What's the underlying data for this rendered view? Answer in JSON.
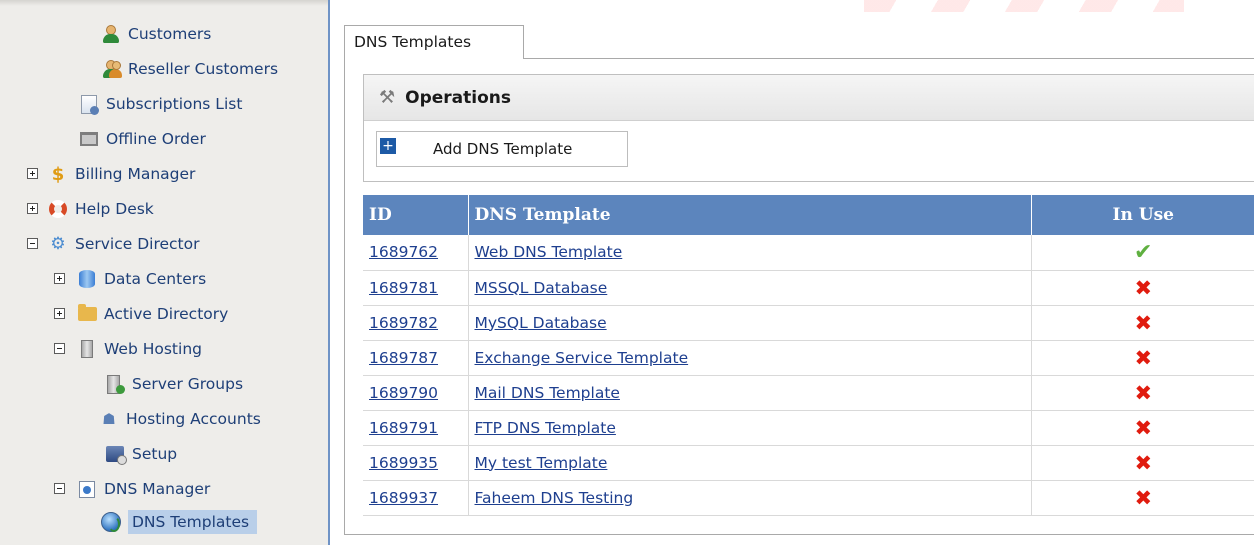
{
  "sidebar": {
    "items": [
      {
        "label": "Customers",
        "icon": "customers-icon"
      },
      {
        "label": "Reseller Customers",
        "icon": "reseller-customers-icon"
      },
      {
        "label": "Subscriptions List",
        "icon": "subscriptions-icon"
      },
      {
        "label": "Offline Order",
        "icon": "cart-icon"
      },
      {
        "label": "Billing Manager",
        "icon": "dollar-icon"
      },
      {
        "label": "Help Desk",
        "icon": "lifering-icon"
      },
      {
        "label": "Service Director",
        "icon": "gears-icon"
      },
      {
        "label": "Data Centers",
        "icon": "database-icon"
      },
      {
        "label": "Active Directory",
        "icon": "folder-icon"
      },
      {
        "label": "Web Hosting",
        "icon": "server-icon"
      },
      {
        "label": "Server Groups",
        "icon": "server-group-icon"
      },
      {
        "label": "Hosting Accounts",
        "icon": "hosting-accounts-icon"
      },
      {
        "label": "Setup",
        "icon": "setup-icon"
      },
      {
        "label": "DNS Manager",
        "icon": "dns-manager-icon"
      },
      {
        "label": "DNS Templates",
        "icon": "globe-icon"
      }
    ]
  },
  "main": {
    "tab_label": "DNS Templates",
    "operations": {
      "title": "Operations",
      "add_button_label": "Add DNS Template",
      "add_icon_glyph": "+"
    },
    "table": {
      "headers": {
        "id": "ID",
        "template": "DNS Template",
        "in_use": "In Use"
      },
      "rows": [
        {
          "id": "1689762",
          "name": "Web DNS Template",
          "in_use": true
        },
        {
          "id": "1689781",
          "name": "MSSQL Database",
          "in_use": false
        },
        {
          "id": "1689782",
          "name": "MySQL Database",
          "in_use": false
        },
        {
          "id": "1689787",
          "name": "Exchange Service Template",
          "in_use": false
        },
        {
          "id": "1689790",
          "name": "Mail DNS Template",
          "in_use": false
        },
        {
          "id": "1689791",
          "name": "FTP DNS Template",
          "in_use": false
        },
        {
          "id": "1689935",
          "name": "My test Template",
          "in_use": false
        },
        {
          "id": "1689937",
          "name": "Faheem DNS Testing",
          "in_use": false
        }
      ]
    }
  },
  "colors": {
    "header_blue": "#5c85bd",
    "link": "#1e3f8f",
    "check_green": "#5fb040",
    "cross_red": "#e01c0f",
    "selected_bg": "#b9cfe9"
  }
}
